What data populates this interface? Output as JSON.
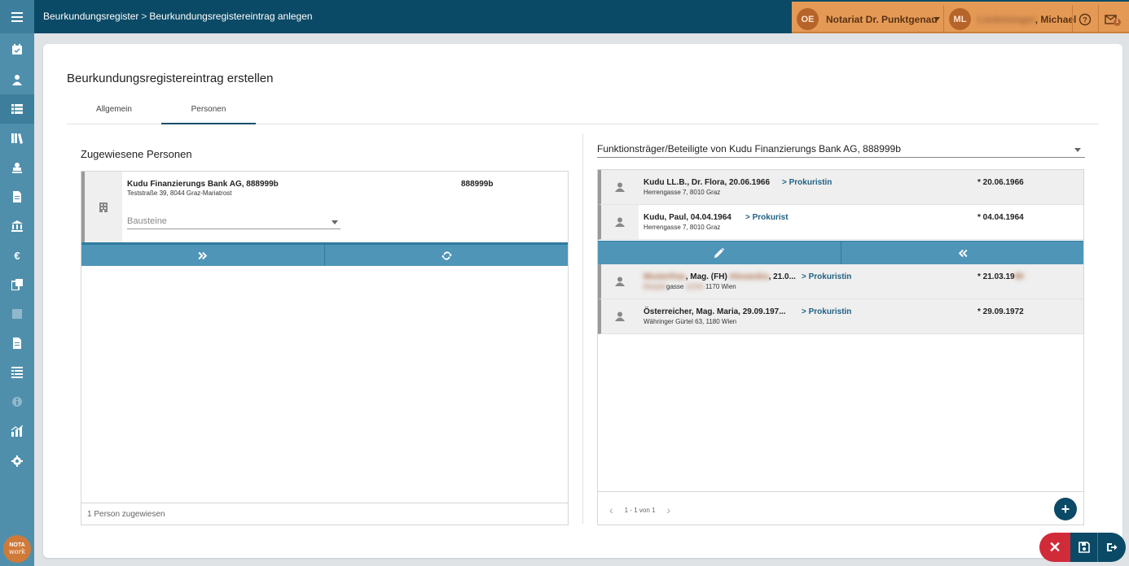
{
  "breadcrumb": {
    "root": "Beurkundungsregister",
    "separator": ">",
    "current": "Beurkundungsregistereintrag anlegen"
  },
  "user_box": {
    "office_initials": "OE",
    "office_name": "Notariat Dr. Punktgenau",
    "user_initials": "ML",
    "user_name_blurred": "Lindelsinger",
    "user_name_visible": ", Michael",
    "mail_badge": "1"
  },
  "sidebar": {
    "items": [
      "menu-icon",
      "calendar-icon",
      "person-icon",
      "list-icon",
      "books-icon",
      "stamp-icon",
      "document-icon",
      "bank-icon",
      "euro-icon",
      "copy-icon",
      "square-icon",
      "file-icon",
      "ledger-icon",
      "info-icon",
      "chart-icon",
      "gear-icon"
    ],
    "logo_top": "NOTA",
    "logo_bottom": "work"
  },
  "page": {
    "title": "Beurkundungsregistereintrag erstellen",
    "tabs": [
      {
        "label": "Allgemein"
      },
      {
        "label": "Personen"
      }
    ]
  },
  "left": {
    "section_title": "Zugewiesene Personen",
    "person": {
      "name": "Kudu Finanzierungs Bank AG, 888999b",
      "address": "Teststraße 39, 8044 Graz-Mariatrost",
      "id": "888999b",
      "bausteine_placeholder": "Bausteine"
    },
    "footer": "1 Person zugewiesen"
  },
  "right": {
    "select_value": "Funktionsträger/Beteiligte von Kudu Finanzierungs Bank AG, 888999b",
    "top_rows": [
      {
        "name": "Kudu LL.B., Dr. Flora, 20.06.1966",
        "function": "> Prokuristin",
        "address": "Herrengasse 7, 8010 Graz",
        "date": "* 20.06.1966"
      },
      {
        "name": "Kudu, Paul, 04.04.1964",
        "function": "> Prokurist",
        "address": "Herrengasse 7, 8010 Graz",
        "date": "* 04.04.1964"
      }
    ],
    "bottom_rows": [
      {
        "name_blur": "Musterfrau",
        "name": ", Mag. (FH) ",
        "name_blur2": "Alexandra",
        "name_tail": ", 21.0...",
        "function": "> Prokuristin",
        "address_blur": "Beispiel",
        "address": "gasse ",
        "address_blur2": "12/3/4",
        "address_tail": " 1170 Wien",
        "date": "* 21.03.19",
        "date_blur": "80"
      },
      {
        "name": "Österreicher, Mag. Maria, 29.09.197...",
        "function": "> Prokuristin",
        "address": "Währinger Gürtel 63, 1180 Wien",
        "date": "* 29.09.1972"
      }
    ],
    "pager": "1 - 1 von 1"
  },
  "colors": {
    "topbar": "#0b4a66",
    "sidebar": "#4f8fac",
    "accent_orange": "#e49a55",
    "action_bar": "#4f95b8",
    "close_red": "#d12b3a"
  }
}
